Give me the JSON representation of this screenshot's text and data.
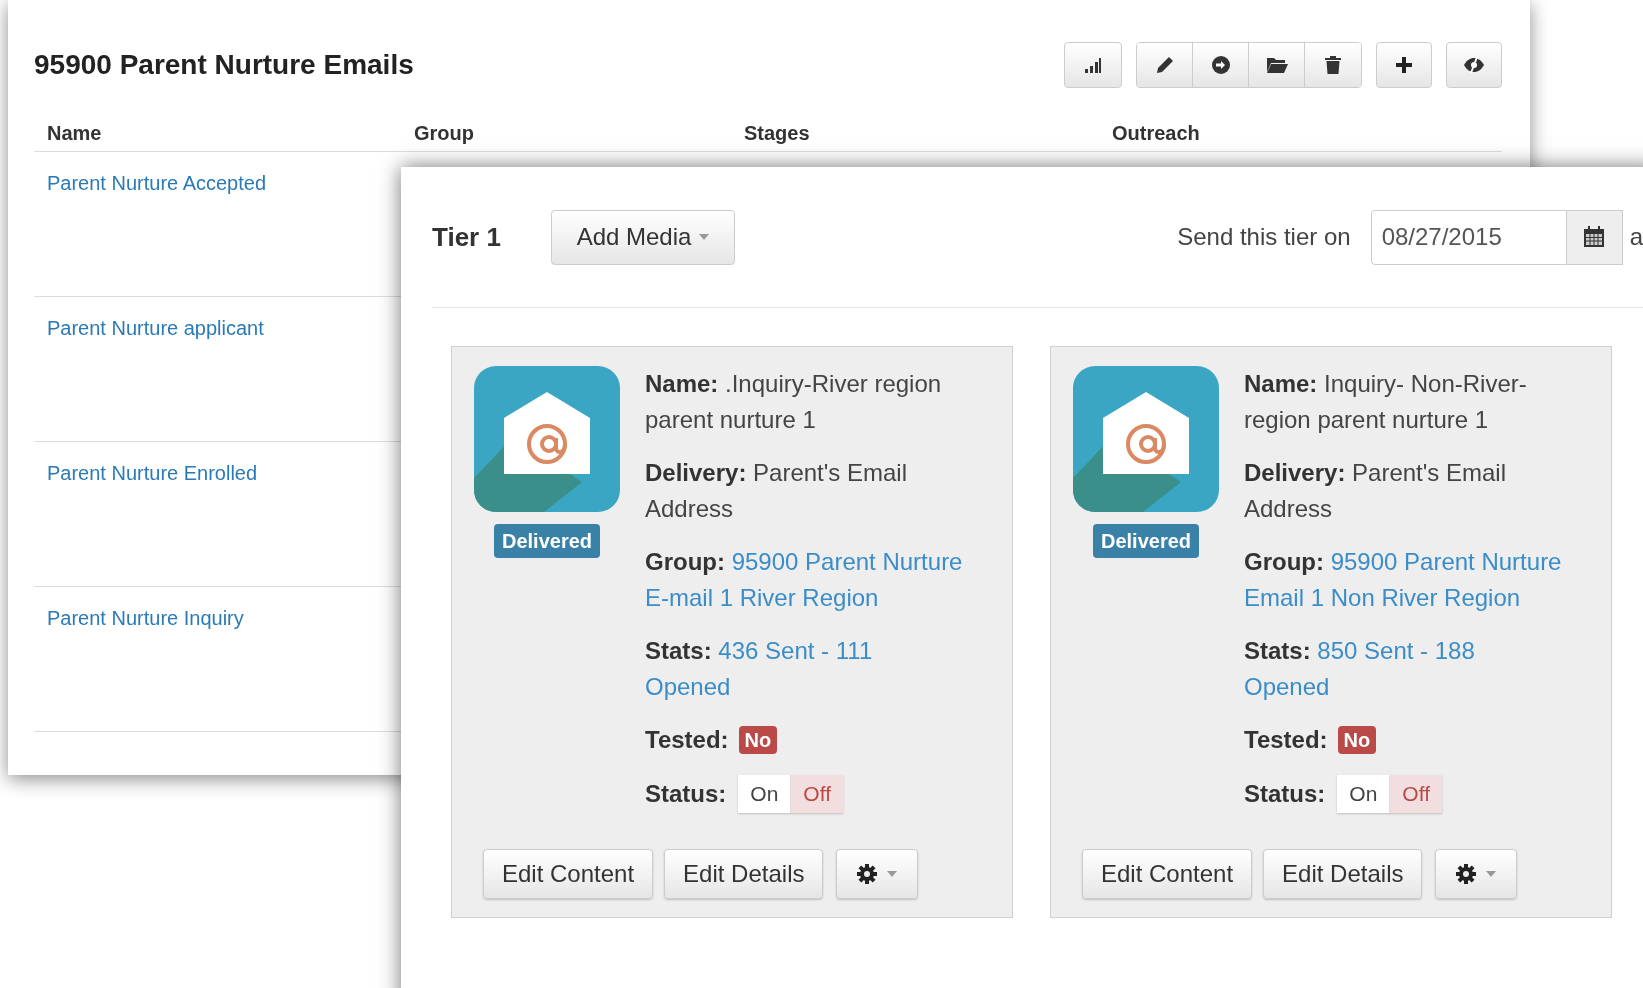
{
  "back_window": {
    "title": "95900 Parent Nurture Emails",
    "columns": [
      "Name",
      "Group",
      "Stages",
      "Outreach"
    ],
    "rows": [
      {
        "name": "Parent Nurture Accepted"
      },
      {
        "name": "Parent Nurture applicant"
      },
      {
        "name": "Parent Nurture Enrolled"
      },
      {
        "name": "Parent Nurture Inquiry"
      }
    ]
  },
  "front_window": {
    "tier_label": "Tier 1",
    "add_media": "Add Media",
    "send_label": "Send this tier on",
    "date": "08/27/2015",
    "cut_text": "a",
    "cards": [
      {
        "badge": "Delivered",
        "fields": [
          {
            "kind": "text",
            "label": "Name:",
            "value": ".Inquiry-River region parent nurture 1"
          },
          {
            "kind": "text",
            "label": "Delivery:",
            "value": "Parent's Email Address"
          },
          {
            "kind": "link",
            "label": "Group:",
            "value": "95900 Parent Nurture E-mail 1 River Region"
          },
          {
            "kind": "link",
            "label": "Stats:",
            "value": "436 Sent - 111 Opened"
          },
          {
            "kind": "badge",
            "label": "Tested:",
            "value": "No"
          },
          {
            "kind": "toggle",
            "label": "Status:",
            "options": [
              {
                "label": "On",
                "selected": false
              },
              {
                "label": "Off",
                "selected": true
              }
            ]
          }
        ],
        "buttons": [
          "Edit Content",
          "Edit Details"
        ]
      },
      {
        "badge": "Delivered",
        "fields": [
          {
            "kind": "text",
            "label": "Name:",
            "value": "Inquiry- Non-River- region parent nurture 1"
          },
          {
            "kind": "text",
            "label": "Delivery:",
            "value": "Parent's Email Address"
          },
          {
            "kind": "link",
            "label": "Group:",
            "value": "95900 Parent Nurture Email 1 Non River Region"
          },
          {
            "kind": "link",
            "label": "Stats:",
            "value": "850 Sent - 188 Opened"
          },
          {
            "kind": "badge",
            "label": "Tested:",
            "value": "No"
          },
          {
            "kind": "toggle",
            "label": "Status:",
            "options": [
              {
                "label": "On",
                "selected": false
              },
              {
                "label": "Off",
                "selected": true
              }
            ]
          }
        ],
        "buttons": [
          "Edit Content",
          "Edit Details"
        ]
      }
    ]
  }
}
